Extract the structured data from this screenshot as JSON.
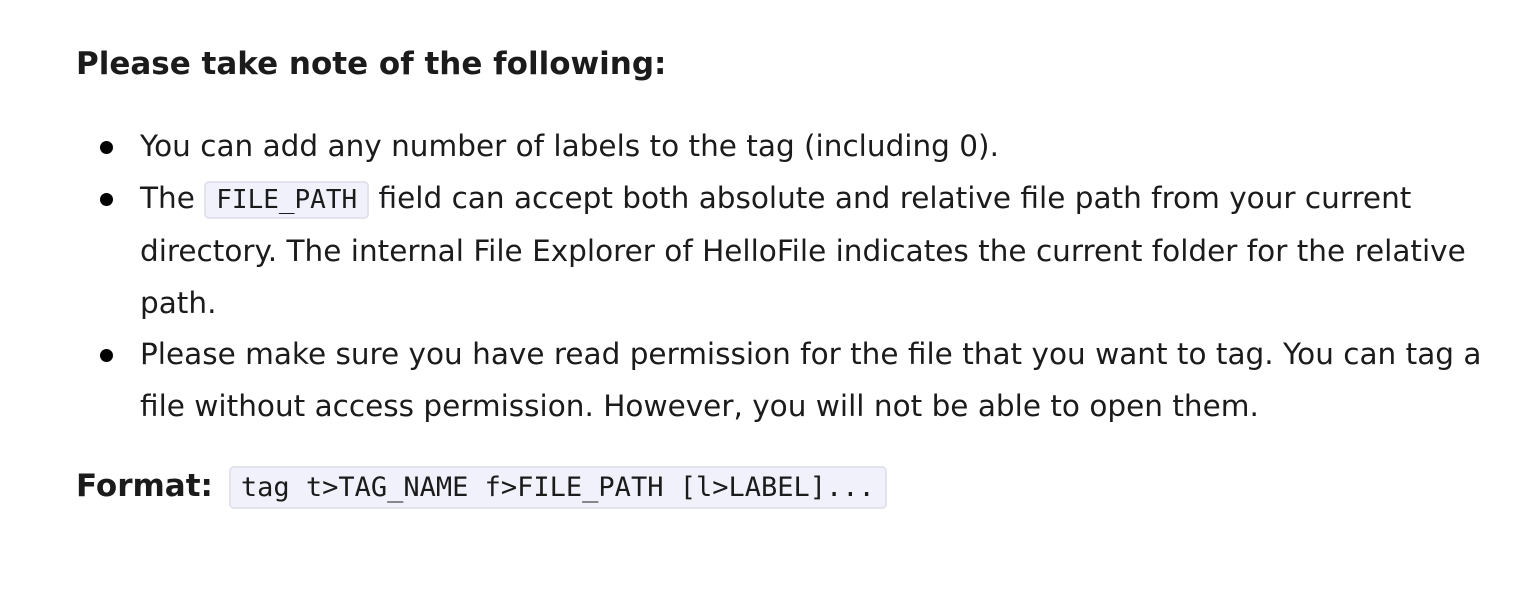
{
  "heading": "Please take note of the following:",
  "notes": [
    {
      "text": "You can add any number of labels to the tag (including 0)."
    },
    {
      "before": "The",
      "code": "FILE_PATH",
      "after": "field can accept both absolute and relative file path from your current directory. The internal File Explorer of HelloFile indicates the current folder for the relative path."
    },
    {
      "text": "Please make sure you have read permission for the file that you want to tag. You can tag a file without access permission. However, you will not be able to open them."
    }
  ],
  "format": {
    "label": "Format:",
    "code": "tag t>TAG_NAME f>FILE_PATH [l>LABEL]..."
  }
}
